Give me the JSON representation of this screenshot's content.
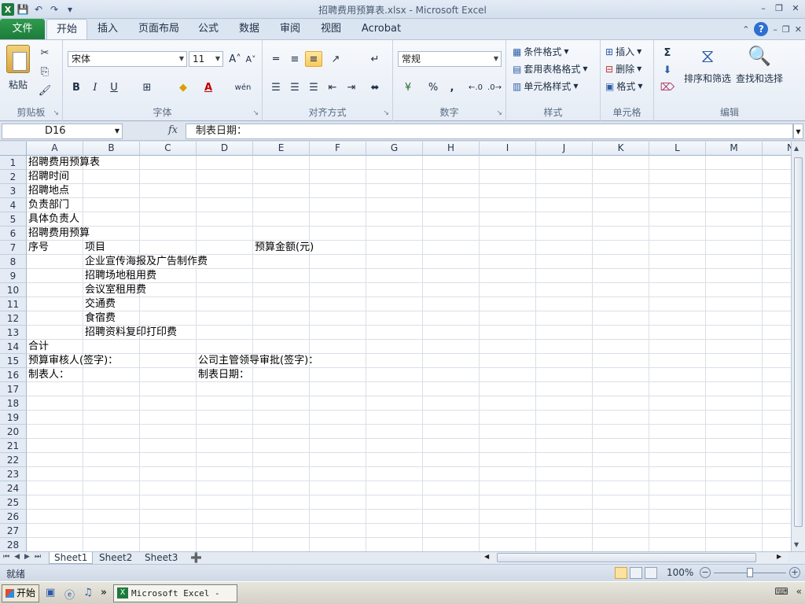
{
  "window": {
    "title": "招聘费用预算表.xlsx - Microsoft Excel"
  },
  "ribbon_tabs": [
    "文件",
    "开始",
    "插入",
    "页面布局",
    "公式",
    "数据",
    "审阅",
    "视图",
    "Acrobat"
  ],
  "ribbon": {
    "clipboard": {
      "paste": "粘贴",
      "label": "剪贴板"
    },
    "font": {
      "name": "宋体",
      "size": "11",
      "bold": "B",
      "italic": "I",
      "underline": "U",
      "wen": "wén",
      "label": "字体"
    },
    "alignment": {
      "label": "对齐方式"
    },
    "number": {
      "format": "常规",
      "percent": "%",
      "comma": ",",
      "label": "数字"
    },
    "styles": {
      "conditional": "条件格式",
      "table": "套用表格格式",
      "cell": "单元格样式",
      "label": "样式"
    },
    "cells": {
      "insert": "插入",
      "delete": "删除",
      "format": "格式",
      "label": "单元格"
    },
    "editing": {
      "sum": "Σ",
      "sort": "排序和筛选",
      "find": "查找和选择",
      "label": "编辑"
    }
  },
  "formula_bar": {
    "name_box": "D16",
    "fx": "fx",
    "content": "制表日期："
  },
  "grid": {
    "columns": [
      "A",
      "B",
      "C",
      "D",
      "E",
      "F",
      "G",
      "H",
      "I",
      "J",
      "K",
      "L",
      "M",
      "N"
    ],
    "rows": [
      "1",
      "2",
      "3",
      "4",
      "5",
      "6",
      "7",
      "8",
      "9",
      "10",
      "11",
      "12",
      "13",
      "14",
      "15",
      "16",
      "17",
      "18",
      "19",
      "20",
      "21",
      "22",
      "23",
      "24",
      "25",
      "26",
      "27",
      "28"
    ],
    "cells": {
      "A1": "招聘费用预算表",
      "A2": "招聘时间",
      "A3": "招聘地点",
      "A4": "负责部门",
      "A5": "具体负责人",
      "A6": "招聘费用预算",
      "A7": "序号",
      "B7": "项目",
      "E7": "预算金额(元)",
      "B8": "企业宣传海报及广告制作费",
      "B9": "招聘场地租用费",
      "B10": "会议室租用费",
      "B11": "交通费",
      "B12": "食宿费",
      "B13": "招聘资料复印打印费",
      "A14": "合计",
      "A15": "预算审核人(签字)：",
      "D15": "公司主管领导审批(签字)：",
      "A16": "制表人：",
      "D16": "制表日期："
    }
  },
  "sheets": [
    "Sheet1",
    "Sheet2",
    "Sheet3"
  ],
  "status": {
    "ready": "就绪",
    "zoom": "100%"
  },
  "taskbar": {
    "start": "开始",
    "task": "Microsoft Excel - ..."
  }
}
